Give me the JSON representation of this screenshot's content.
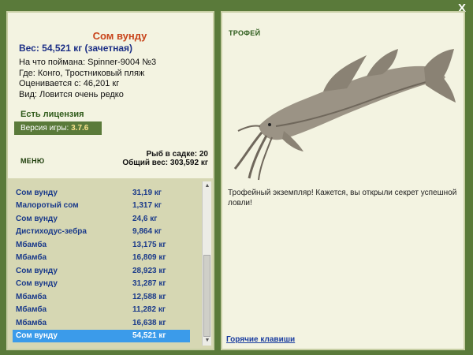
{
  "window": {
    "close_label": "X"
  },
  "fish": {
    "name": "Сом вунду",
    "weight_line": "Вес: 54,521 кг (зачетная)",
    "caught_on": "На что поймана: Spinner-9004 №3",
    "location": "Где: Конго, Тростниковый пляж",
    "valued_from": "Оценивается с: 46,201 кг",
    "rarity": "Вид: Ловится очень редко"
  },
  "license_text": "Есть лицензия",
  "version": {
    "label": "Версия игры:",
    "value": "3.7.6"
  },
  "menu_label": "МЕНЮ",
  "stats": {
    "count_line": "Рыб в садке: 20",
    "total_line": "Общий вес: 303,592 кг"
  },
  "catch_list": [
    {
      "name": "Сом вунду",
      "weight": "31,19 кг"
    },
    {
      "name": "Малоротый сом",
      "weight": "1,317 кг"
    },
    {
      "name": "Сом вунду",
      "weight": "24,6 кг"
    },
    {
      "name": "Дистиходус-зебра",
      "weight": "9,864 кг"
    },
    {
      "name": "Мбамба",
      "weight": "13,175 кг"
    },
    {
      "name": "Мбамба",
      "weight": "16,809 кг"
    },
    {
      "name": "Сом вунду",
      "weight": "28,923 кг"
    },
    {
      "name": "Сом вунду",
      "weight": "31,287 кг"
    },
    {
      "name": "Мбамба",
      "weight": "12,588 кг"
    },
    {
      "name": "Мбамба",
      "weight": "11,282 кг"
    },
    {
      "name": "Мбамба",
      "weight": "16,638 кг"
    },
    {
      "name": "Сом вунду",
      "weight": "54,521 кг"
    }
  ],
  "selected_index": 11,
  "trophy": {
    "title": "ТРОФЕЙ",
    "text": "Трофейный экземпляр! Кажется, вы открыли секрет успешной ловли!"
  },
  "hotkeys_label": "Горячие клавиши",
  "colors": {
    "background": "#5a7a3a",
    "panel": "#f3f3e1",
    "selected_row": "#3b9bea",
    "fish_name": "#c8441b"
  }
}
